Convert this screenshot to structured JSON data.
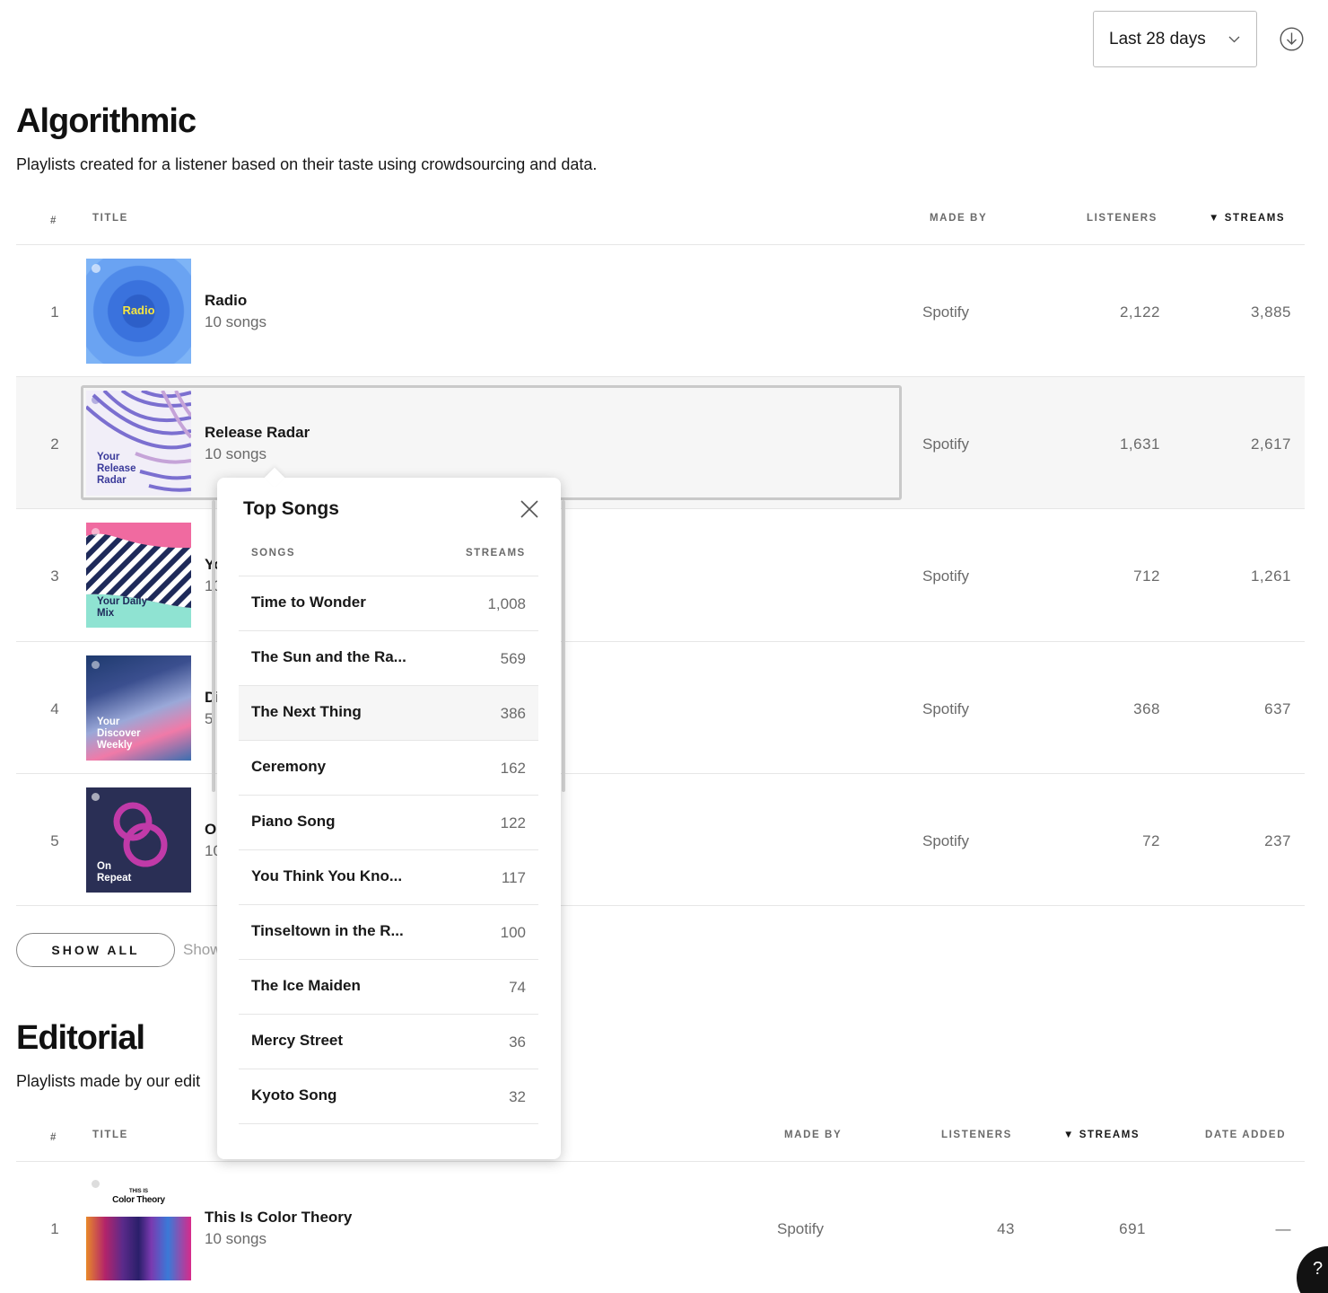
{
  "header": {
    "date_range": "Last 28 days"
  },
  "algorithmic": {
    "title": "Algorithmic",
    "description": "Playlists created for a listener based on their taste using crowdsourcing and data.",
    "columns": {
      "rank": "#",
      "title": "TITLE",
      "made_by": "MADE BY",
      "listeners": "LISTENERS",
      "streams": "STREAMS"
    },
    "sort_indicator": "▼",
    "rows": [
      {
        "rank": "1",
        "title": "Radio",
        "subtitle": "10 songs",
        "made_by": "Spotify",
        "listeners": "2,122",
        "streams": "3,885",
        "art_text": "Radio"
      },
      {
        "rank": "2",
        "title": "Release Radar",
        "subtitle": "10 songs",
        "made_by": "Spotify",
        "listeners": "1,631",
        "streams": "2,617",
        "art_text": "Your Release Radar"
      },
      {
        "rank": "3",
        "title": "Yo",
        "subtitle": "10",
        "made_by": "Spotify",
        "listeners": "712",
        "streams": "1,261",
        "art_text": "Your Daily Mix"
      },
      {
        "rank": "4",
        "title": "Di",
        "subtitle": "5",
        "made_by": "Spotify",
        "listeners": "368",
        "streams": "637",
        "art_text": "Your Discover Weekly"
      },
      {
        "rank": "5",
        "title": "O",
        "subtitle": "10",
        "made_by": "Spotify",
        "listeners": "72",
        "streams": "237",
        "art_text": "On Repeat"
      }
    ],
    "show_all": "SHOW ALL",
    "show_hint": "Show"
  },
  "editorial": {
    "title": "Editorial",
    "description": "Playlists made by our edit",
    "columns": {
      "rank": "#",
      "title": "TITLE",
      "made_by": "MADE BY",
      "listeners": "LISTENERS",
      "streams": "STREAMS",
      "date_added": "DATE ADDED"
    },
    "rows": [
      {
        "rank": "1",
        "title": "This Is Color Theory",
        "subtitle": "10 songs",
        "made_by": "Spotify",
        "listeners": "43",
        "streams": "691",
        "date_added": "—",
        "art_top": "THIS IS",
        "art_name": "Color Theory"
      }
    ]
  },
  "popover": {
    "title": "Top Songs",
    "col_songs": "SONGS",
    "col_streams": "STREAMS",
    "songs": [
      {
        "name": "Time to Wonder",
        "streams": "1,008"
      },
      {
        "name": "The Sun and the Ra...",
        "streams": "569"
      },
      {
        "name": "The Next Thing",
        "streams": "386"
      },
      {
        "name": "Ceremony",
        "streams": "162"
      },
      {
        "name": "Piano Song",
        "streams": "122"
      },
      {
        "name": "You Think You Kno...",
        "streams": "117"
      },
      {
        "name": "Tinseltown in the R...",
        "streams": "100"
      },
      {
        "name": "The Ice Maiden",
        "streams": "74"
      },
      {
        "name": "Mercy Street",
        "streams": "36"
      },
      {
        "name": "Kyoto Song",
        "streams": "32"
      }
    ]
  },
  "help": {
    "label": "?"
  },
  "colors": {
    "radio_text": "#f5e642",
    "radar_stripes": "#7b6fd0",
    "daily_pink": "#f06aa0",
    "daily_teal": "#8fe3d2",
    "onrepeat_bg": "#2a2f55",
    "onrepeat_ring": "#c03aa8"
  }
}
